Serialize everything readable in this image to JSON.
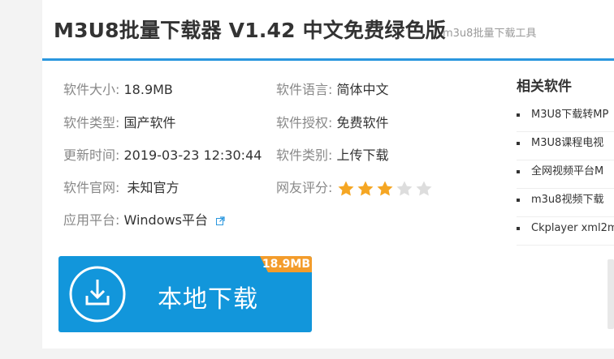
{
  "header": {
    "title": "M3U8批量下载器 V1.42 中文免费绿色版",
    "subtitle": "m3u8批量下载工具"
  },
  "info": {
    "size": {
      "label": "软件大小:",
      "value": "18.9MB"
    },
    "type": {
      "label": "软件类型:",
      "value": "国产软件"
    },
    "updated": {
      "label": "更新时间:",
      "value": "2019-03-23 12:30:44"
    },
    "website": {
      "label": "软件官网:",
      "value": "未知官方"
    },
    "platform": {
      "label": "应用平台:",
      "value": "Windows平台"
    },
    "language": {
      "label": "软件语言:",
      "value": "简体中文"
    },
    "license": {
      "label": "软件授权:",
      "value": "免费软件"
    },
    "category": {
      "label": "软件类别:",
      "value": "上传下载"
    },
    "rating": {
      "label": "网友评分:",
      "value": 3,
      "max": 5
    }
  },
  "download": {
    "label": "本地下载",
    "size_badge": "18.9MB",
    "icon": "download-arrow-icon"
  },
  "related": {
    "title": "相关软件",
    "items": [
      "M3U8下载转MP",
      "M3U8课程电视",
      "全网视频平台M",
      "m3u8视频下载",
      "Ckplayer xml2m"
    ]
  },
  "colors": {
    "accent": "#2a97de",
    "button": "#1296db",
    "badge": "#f39c2b",
    "star_on": "#f5a623",
    "star_off": "#dddddd",
    "label": "#888888"
  }
}
